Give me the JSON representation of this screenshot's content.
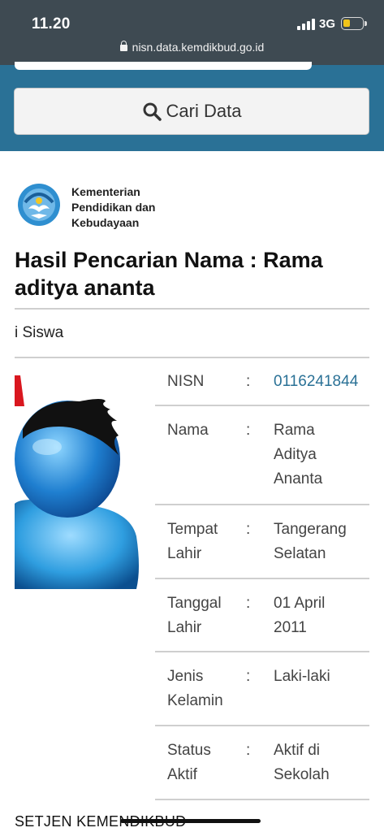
{
  "status": {
    "time": "11.20",
    "network": "3G"
  },
  "browser": {
    "url": "nisn.data.kemdikbud.go.id"
  },
  "search": {
    "button_label": "Cari Data"
  },
  "ministry": {
    "line1": "Kementerian",
    "line2": "Pendidikan dan",
    "line3": "Kebudayaan"
  },
  "heading": {
    "line1": "Hasil Pencarian Nama : Rama",
    "line2": "aditya ananta"
  },
  "section": {
    "label": "i Siswa"
  },
  "info_rows": [
    {
      "label_line1": "NISN",
      "label_line2": "",
      "value_line1": "0116241844",
      "value_line2": "",
      "value_line3": ""
    },
    {
      "label_line1": "Nama",
      "label_line2": "",
      "value_line1": "Rama",
      "value_line2": "Aditya",
      "value_line3": "Ananta"
    },
    {
      "label_line1": "Tempat",
      "label_line2": "Lahir",
      "value_line1": "Tangerang",
      "value_line2": "Selatan",
      "value_line3": ""
    },
    {
      "label_line1": "Tanggal",
      "label_line2": "Lahir",
      "value_line1": "01 April",
      "value_line2": "2011",
      "value_line3": ""
    },
    {
      "label_line1": "Jenis",
      "label_line2": "Kelamin",
      "value_line1": "Laki-laki",
      "value_line2": "",
      "value_line3": ""
    },
    {
      "label_line1": "Status",
      "label_line2": "Aktif",
      "value_line1": "Aktif di",
      "value_line2": "Sekolah",
      "value_line3": ""
    }
  ],
  "separator": ":",
  "footer": {
    "text": "SETJEN KEMENDIKBUD"
  },
  "colors": {
    "brand_blue": "#2a7196",
    "status_bar": "#3e4a52",
    "battery": "#f0c419"
  },
  "icons": [
    "signal-icon",
    "battery-icon",
    "lock-icon",
    "search-icon",
    "ministry-logo",
    "avatar-image"
  ]
}
